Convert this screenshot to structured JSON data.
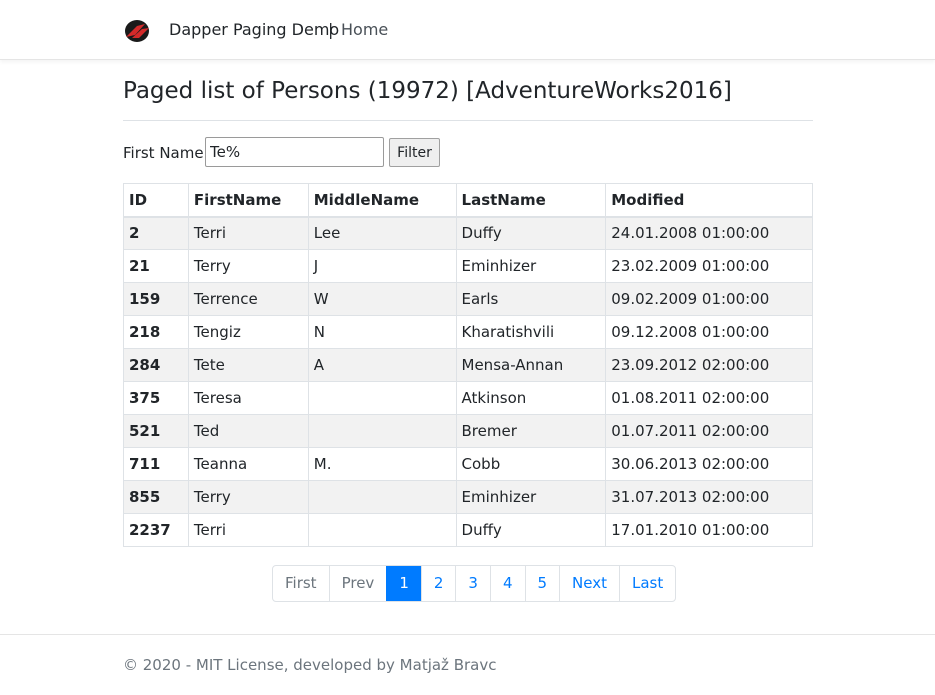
{
  "header": {
    "brand": "Dapper Paging Demo",
    "separator": "|",
    "home": "Home",
    "logo_icon": "dapper-logo-icon",
    "logo_color": "#d42a2a"
  },
  "page": {
    "title": "Paged list of Persons (19972) [AdventureWorks2016]"
  },
  "filter": {
    "label": "First Name:",
    "value": "Te%",
    "button": "Filter"
  },
  "table": {
    "columns": [
      "ID",
      "FirstName",
      "MiddleName",
      "LastName",
      "Modified"
    ],
    "rows": [
      [
        "2",
        "Terri",
        "Lee",
        "Duffy",
        "24.01.2008 01:00:00"
      ],
      [
        "21",
        "Terry",
        "J",
        "Eminhizer",
        "23.02.2009 01:00:00"
      ],
      [
        "159",
        "Terrence",
        "W",
        "Earls",
        "09.02.2009 01:00:00"
      ],
      [
        "218",
        "Tengiz",
        "N",
        "Kharatishvili",
        "09.12.2008 01:00:00"
      ],
      [
        "284",
        "Tete",
        "A",
        "Mensa-Annan",
        "23.09.2012 02:00:00"
      ],
      [
        "375",
        "Teresa",
        "",
        "Atkinson",
        "01.08.2011 02:00:00"
      ],
      [
        "521",
        "Ted",
        "",
        "Bremer",
        "01.07.2011 02:00:00"
      ],
      [
        "711",
        "Teanna",
        "M.",
        "Cobb",
        "30.06.2013 02:00:00"
      ],
      [
        "855",
        "Terry",
        "",
        "Eminhizer",
        "31.07.2013 02:00:00"
      ],
      [
        "2237",
        "Terri",
        "",
        "Duffy",
        "17.01.2010 01:00:00"
      ]
    ]
  },
  "pagination": {
    "first": "First",
    "prev": "Prev",
    "pages": [
      "1",
      "2",
      "3",
      "4",
      "5"
    ],
    "active": "1",
    "next": "Next",
    "last": "Last",
    "link_color": "#007bff"
  },
  "footer": {
    "text": "© 2020 - MIT License, developed by Matjaž Bravc"
  }
}
